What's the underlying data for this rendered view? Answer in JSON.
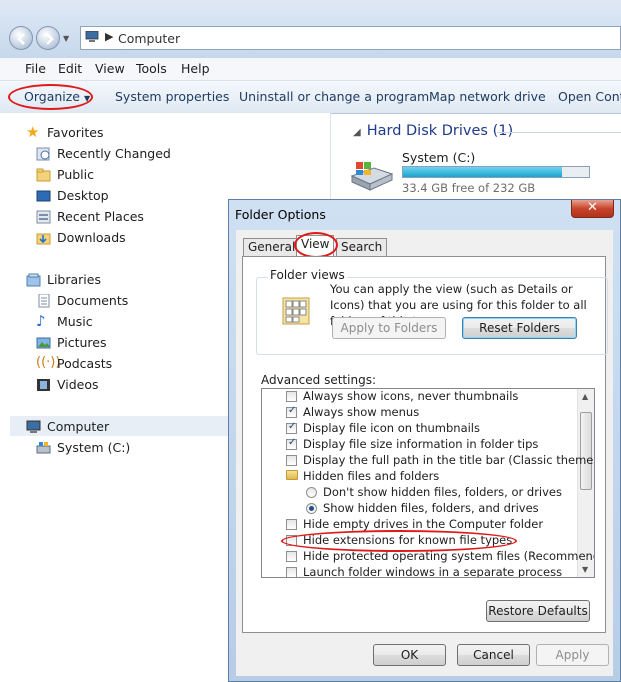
{
  "address": {
    "path": "Computer"
  },
  "menu": [
    "File",
    "Edit",
    "View",
    "Tools",
    "Help"
  ],
  "commands": [
    "Organize",
    "System properties",
    "Uninstall or change a program",
    "Map network drive",
    "Open Contro"
  ],
  "nav": {
    "favorites": {
      "header": "Favorites",
      "items": [
        "Recently Changed",
        "Public",
        "Desktop",
        "Recent Places",
        "Downloads"
      ]
    },
    "libraries": {
      "header": "Libraries",
      "items": [
        "Documents",
        "Music",
        "Pictures",
        "Podcasts",
        "Videos"
      ]
    },
    "computer": {
      "header": "Computer",
      "items": [
        "System (C:)"
      ]
    }
  },
  "content": {
    "section_title": "Hard Disk Drives (1)",
    "drive": {
      "name": "System (C:)",
      "free_text": "33.4 GB free of 232 GB",
      "used_fraction": 0.856,
      "bar_color": "#1ba3cf"
    }
  },
  "dialog": {
    "title": "Folder Options",
    "close_label": "✕",
    "tabs": [
      "General",
      "View",
      "Search"
    ],
    "active_tab": "View",
    "folder_views": {
      "title": "Folder views",
      "text": "You can apply the view (such as Details or Icons) that you are using for this folder to all folders of this type.",
      "apply_button": "Apply to Folders",
      "reset_button": "Reset Folders"
    },
    "advanced_label": "Advanced settings:",
    "settings": [
      {
        "type": "checkbox",
        "label": "Always show icons, never thumbnails",
        "checked": false
      },
      {
        "type": "checkbox",
        "label": "Always show menus",
        "checked": true
      },
      {
        "type": "checkbox",
        "label": "Display file icon on thumbnails",
        "checked": true
      },
      {
        "type": "checkbox",
        "label": "Display file size information in folder tips",
        "checked": true
      },
      {
        "type": "checkbox",
        "label": "Display the full path in the title bar (Classic theme only)",
        "checked": false
      },
      {
        "type": "folder",
        "label": "Hidden files and folders"
      },
      {
        "type": "radio",
        "label": "Don't show hidden files, folders, or drives",
        "checked": false
      },
      {
        "type": "radio",
        "label": "Show hidden files, folders, and drives",
        "checked": true
      },
      {
        "type": "checkbox",
        "label": "Hide empty drives in the Computer folder",
        "checked": false
      },
      {
        "type": "checkbox",
        "label": "Hide extensions for known file types",
        "checked": false
      },
      {
        "type": "checkbox",
        "label": "Hide protected operating system files (Recommended)",
        "checked": false
      },
      {
        "type": "checkbox",
        "label": "Launch folder windows in a separate process",
        "checked": false
      }
    ],
    "restore_button": "Restore Defaults",
    "ok_button": "OK",
    "cancel_button": "Cancel",
    "apply_button": "Apply"
  },
  "highlight_color": "#e01a1a"
}
